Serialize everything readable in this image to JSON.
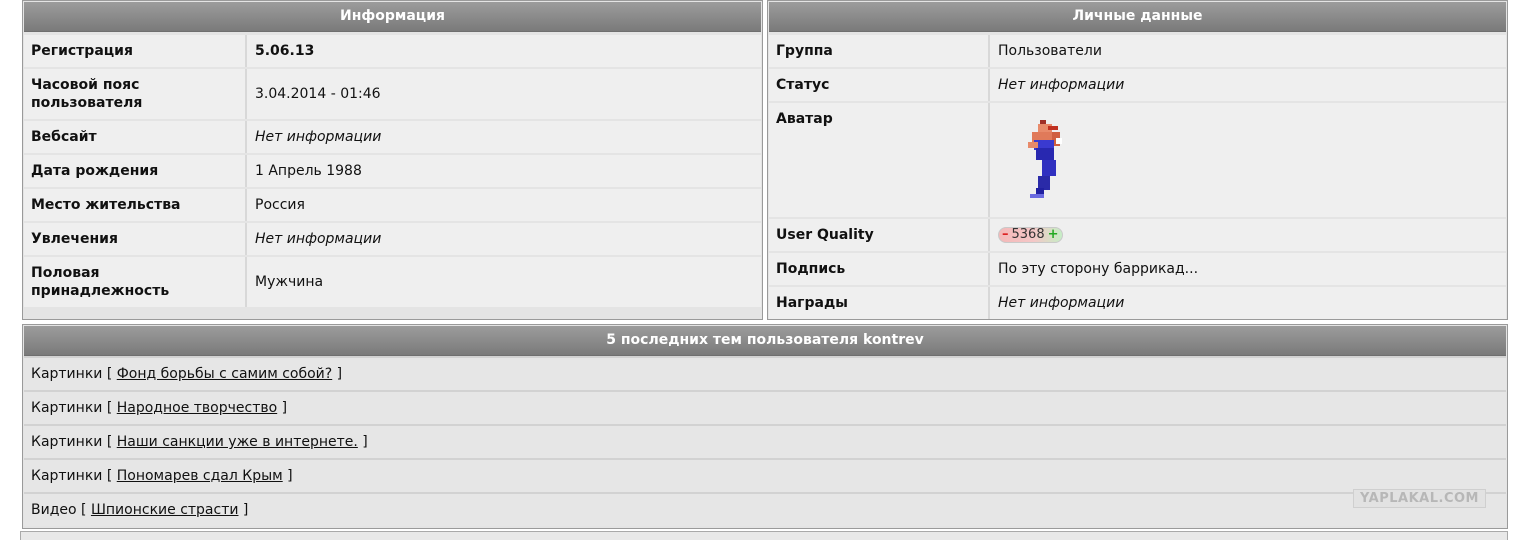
{
  "info_panel": {
    "title": "Информация",
    "rows": [
      {
        "label": "Регистрация",
        "value": "5.06.13",
        "bold": true
      },
      {
        "label": "Часовой пояс пользователя",
        "value": "3.04.2014 - 01:46"
      },
      {
        "label": "Вебсайт",
        "value": "Нет информации",
        "italic": true
      },
      {
        "label": "Дата рождения",
        "value": "1 Апрель 1988"
      },
      {
        "label": "Место жительства",
        "value": "Россия"
      },
      {
        "label": "Увлечения",
        "value": "Нет информации",
        "italic": true
      },
      {
        "label": "Половая принадлежность",
        "value": "Мужчина"
      }
    ]
  },
  "personal_panel": {
    "title": "Личные данные",
    "group_label": "Группа",
    "group_value": "Пользователи",
    "status_label": "Статус",
    "status_value": "Нет информации",
    "avatar_label": "Аватар",
    "quality_label": "User Quality",
    "quality_value": "5368",
    "quality_minus": "–",
    "quality_plus": "+",
    "signature_label": "Подпись",
    "signature_value": "По эту сторону баррикад...",
    "awards_label": "Награды",
    "awards_value": "Нет информации"
  },
  "topics_panel": {
    "title": "5 последних тем пользователя kontrev",
    "items": [
      {
        "category": "Картинки",
        "title": "Фонд борьбы с самим собой?"
      },
      {
        "category": "Картинки",
        "title": "Народное творчество"
      },
      {
        "category": "Картинки",
        "title": "Наши санкции уже в интернете."
      },
      {
        "category": "Картинки",
        "title": "Пономарев сдал Крым"
      },
      {
        "category": "Видео",
        "title": "Шпионские страсти"
      }
    ],
    "bracket_open": "[",
    "bracket_close": "]"
  },
  "watermark": "YAPLAKAL.COM",
  "colors": {
    "header_bg": "#8a8a8a",
    "row_bg": "#efefef",
    "panel_bg": "#e4e4e4",
    "quality_minus": "#d22222",
    "quality_plus": "#22aa22"
  }
}
